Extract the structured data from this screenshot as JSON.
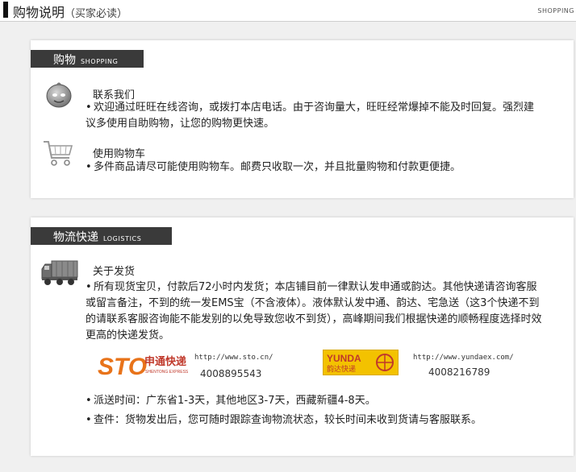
{
  "header": {
    "title": "购物说明",
    "subtitle": "（买家必读）",
    "right_label": "SHOPPING"
  },
  "shopping": {
    "tab_zh": "购物",
    "tab_en": "SHOPPING",
    "contact_title": "联系我们",
    "contact_text": "欢迎通过旺旺在线咨询，或拨打本店电话。由于咨询量大，旺旺经常爆掉不能及时回复。强烈建议多使用自助购物，让您的购物更快速。",
    "cart_title": "使用购物车",
    "cart_text": "多件商品请尽可能使用购物车。邮费只收取一次，并且批量购物和付款更便捷。"
  },
  "logistics": {
    "tab_zh": "物流快递",
    "tab_en": "LOGISTICS",
    "delivery_title": "关于发货",
    "delivery_text": "所有现货宝贝，付款后72小时内发货；本店铺目前一律默认发申通或韵达。其他快递请咨询客服或留言备注，不到的统一发EMS宝（不含液体）。液体默认发中通、韵达、宅急送（这3个快递不到的请联系客服咨询能不能发别的以免导致您收不到货），高峰期间我们根据快递的顺畅程度选择时效更高的快递发货。",
    "carriers": [
      {
        "logo_text": "STO",
        "logo_cn": "申通快递",
        "logo_en": "SHENTONG EXPRESS",
        "url": "http://www.sto.cn/",
        "phone": "4008895543"
      },
      {
        "logo_text": "YUNDA",
        "logo_cn": "韵达快递",
        "url": "http://www.yundaex.com/",
        "phone": "4008216789"
      }
    ],
    "time_text": "派送时间：广东省1-3天，其他地区3-7天，西藏新疆4-8天。",
    "query_text": "查件：货物发出后，您可随时跟踪查询物流状态，较长时间未收到货请与客服联系。"
  },
  "colors": {
    "tab_bg": "#3a3a3a",
    "sto_orange": "#e8731a",
    "sto_red": "#c0392b",
    "yunda_yellow": "#f3c200",
    "yunda_red": "#c0392b"
  },
  "icons": {
    "contact": "chat-bubble-icon",
    "cart": "shopping-cart-icon",
    "truck": "truck-icon"
  }
}
